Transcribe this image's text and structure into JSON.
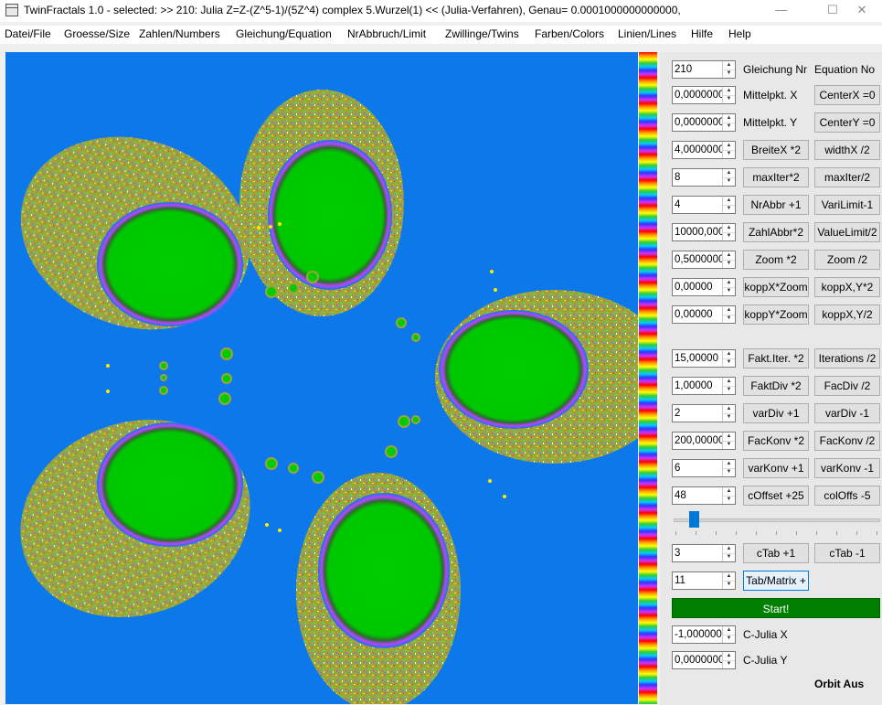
{
  "window": {
    "title": "TwinFractals 1.0 - selected: >> 210: Julia Z=Z-(Z^5-1)/(5Z^4) complex 5.Wurzel(1) << (Julia-Verfahren), Genau= 0.0001000000000000,",
    "minimize": "—",
    "maximize": "☐",
    "close": "✕"
  },
  "menu": [
    "Datei/File",
    "Groesse/Size",
    "Zahlen/Numbers",
    "Gleichung/Equation",
    "NrAbbruch/Limit",
    "Zwillinge/Twins",
    "Farben/Colors",
    "Linien/Lines",
    "Hilfe",
    "Help"
  ],
  "controls": {
    "equation": {
      "value": "210",
      "label": "Gleichung Nr",
      "button": "Equation No"
    },
    "center_x": {
      "value": "0,0000000",
      "label": "Mittelpkt. X",
      "button": "CenterX =0"
    },
    "center_y": {
      "value": "0,0000000",
      "label": "Mittelpkt. Y",
      "button": "CenterY =0"
    },
    "width_x": {
      "value": "4,0000000",
      "button1": "BreiteX *2",
      "button2": "widthX /2"
    },
    "max_iter": {
      "value": "8",
      "button1": "maxIter*2",
      "button2": "maxIter/2"
    },
    "nr_abbr": {
      "value": "4",
      "button1": "NrAbbr +1",
      "button2": "VariLimit-1"
    },
    "zahl_abbr": {
      "value": "10000,000",
      "button1": "ZahlAbbr*2",
      "button2": "ValueLimit/2"
    },
    "zoom": {
      "value": "0,5000000",
      "button1": "Zoom *2",
      "button2": "Zoom /2"
    },
    "kopp_x": {
      "value": "0,00000",
      "button1": "koppX*Zoom",
      "button2": "koppX,Y*2"
    },
    "kopp_y": {
      "value": "0,00000",
      "button1": "koppY*Zoom",
      "button2": "koppX,Y/2"
    },
    "fakt_iter": {
      "value": "15,00000",
      "button1": "Fakt.Iter. *2",
      "button2": "Iterations /2"
    },
    "fakt_div": {
      "value": "1,00000",
      "button1": "FaktDiv *2",
      "button2": "FacDiv /2"
    },
    "var_div": {
      "value": "2",
      "button1": "varDiv +1",
      "button2": "varDiv -1"
    },
    "fac_konv": {
      "value": "200,00000",
      "button1": "FacKonv *2",
      "button2": "FacKonv /2"
    },
    "var_konv": {
      "value": "6",
      "button1": "varKonv +1",
      "button2": "varKonv -1"
    },
    "c_offset": {
      "value": "48",
      "button1": "cOffset +25",
      "button2": "colOffs -5"
    },
    "slider_level": 0.08,
    "c_tab": {
      "value": "3",
      "button1": "cTab +1",
      "button2": "cTab -1"
    },
    "tab_matrix": {
      "value": "11",
      "button1": "Tab/Matrix +"
    },
    "start": "Start!",
    "c_julia_x": {
      "value": "-1,0000000",
      "label": "C-Julia X"
    },
    "c_julia_y": {
      "value": "0,0000000",
      "label": "C-Julia Y"
    },
    "orbit": "Orbit Aus"
  },
  "colors": {
    "background": "#0d78ea",
    "basin": "#00cc00",
    "start": "#008000"
  }
}
